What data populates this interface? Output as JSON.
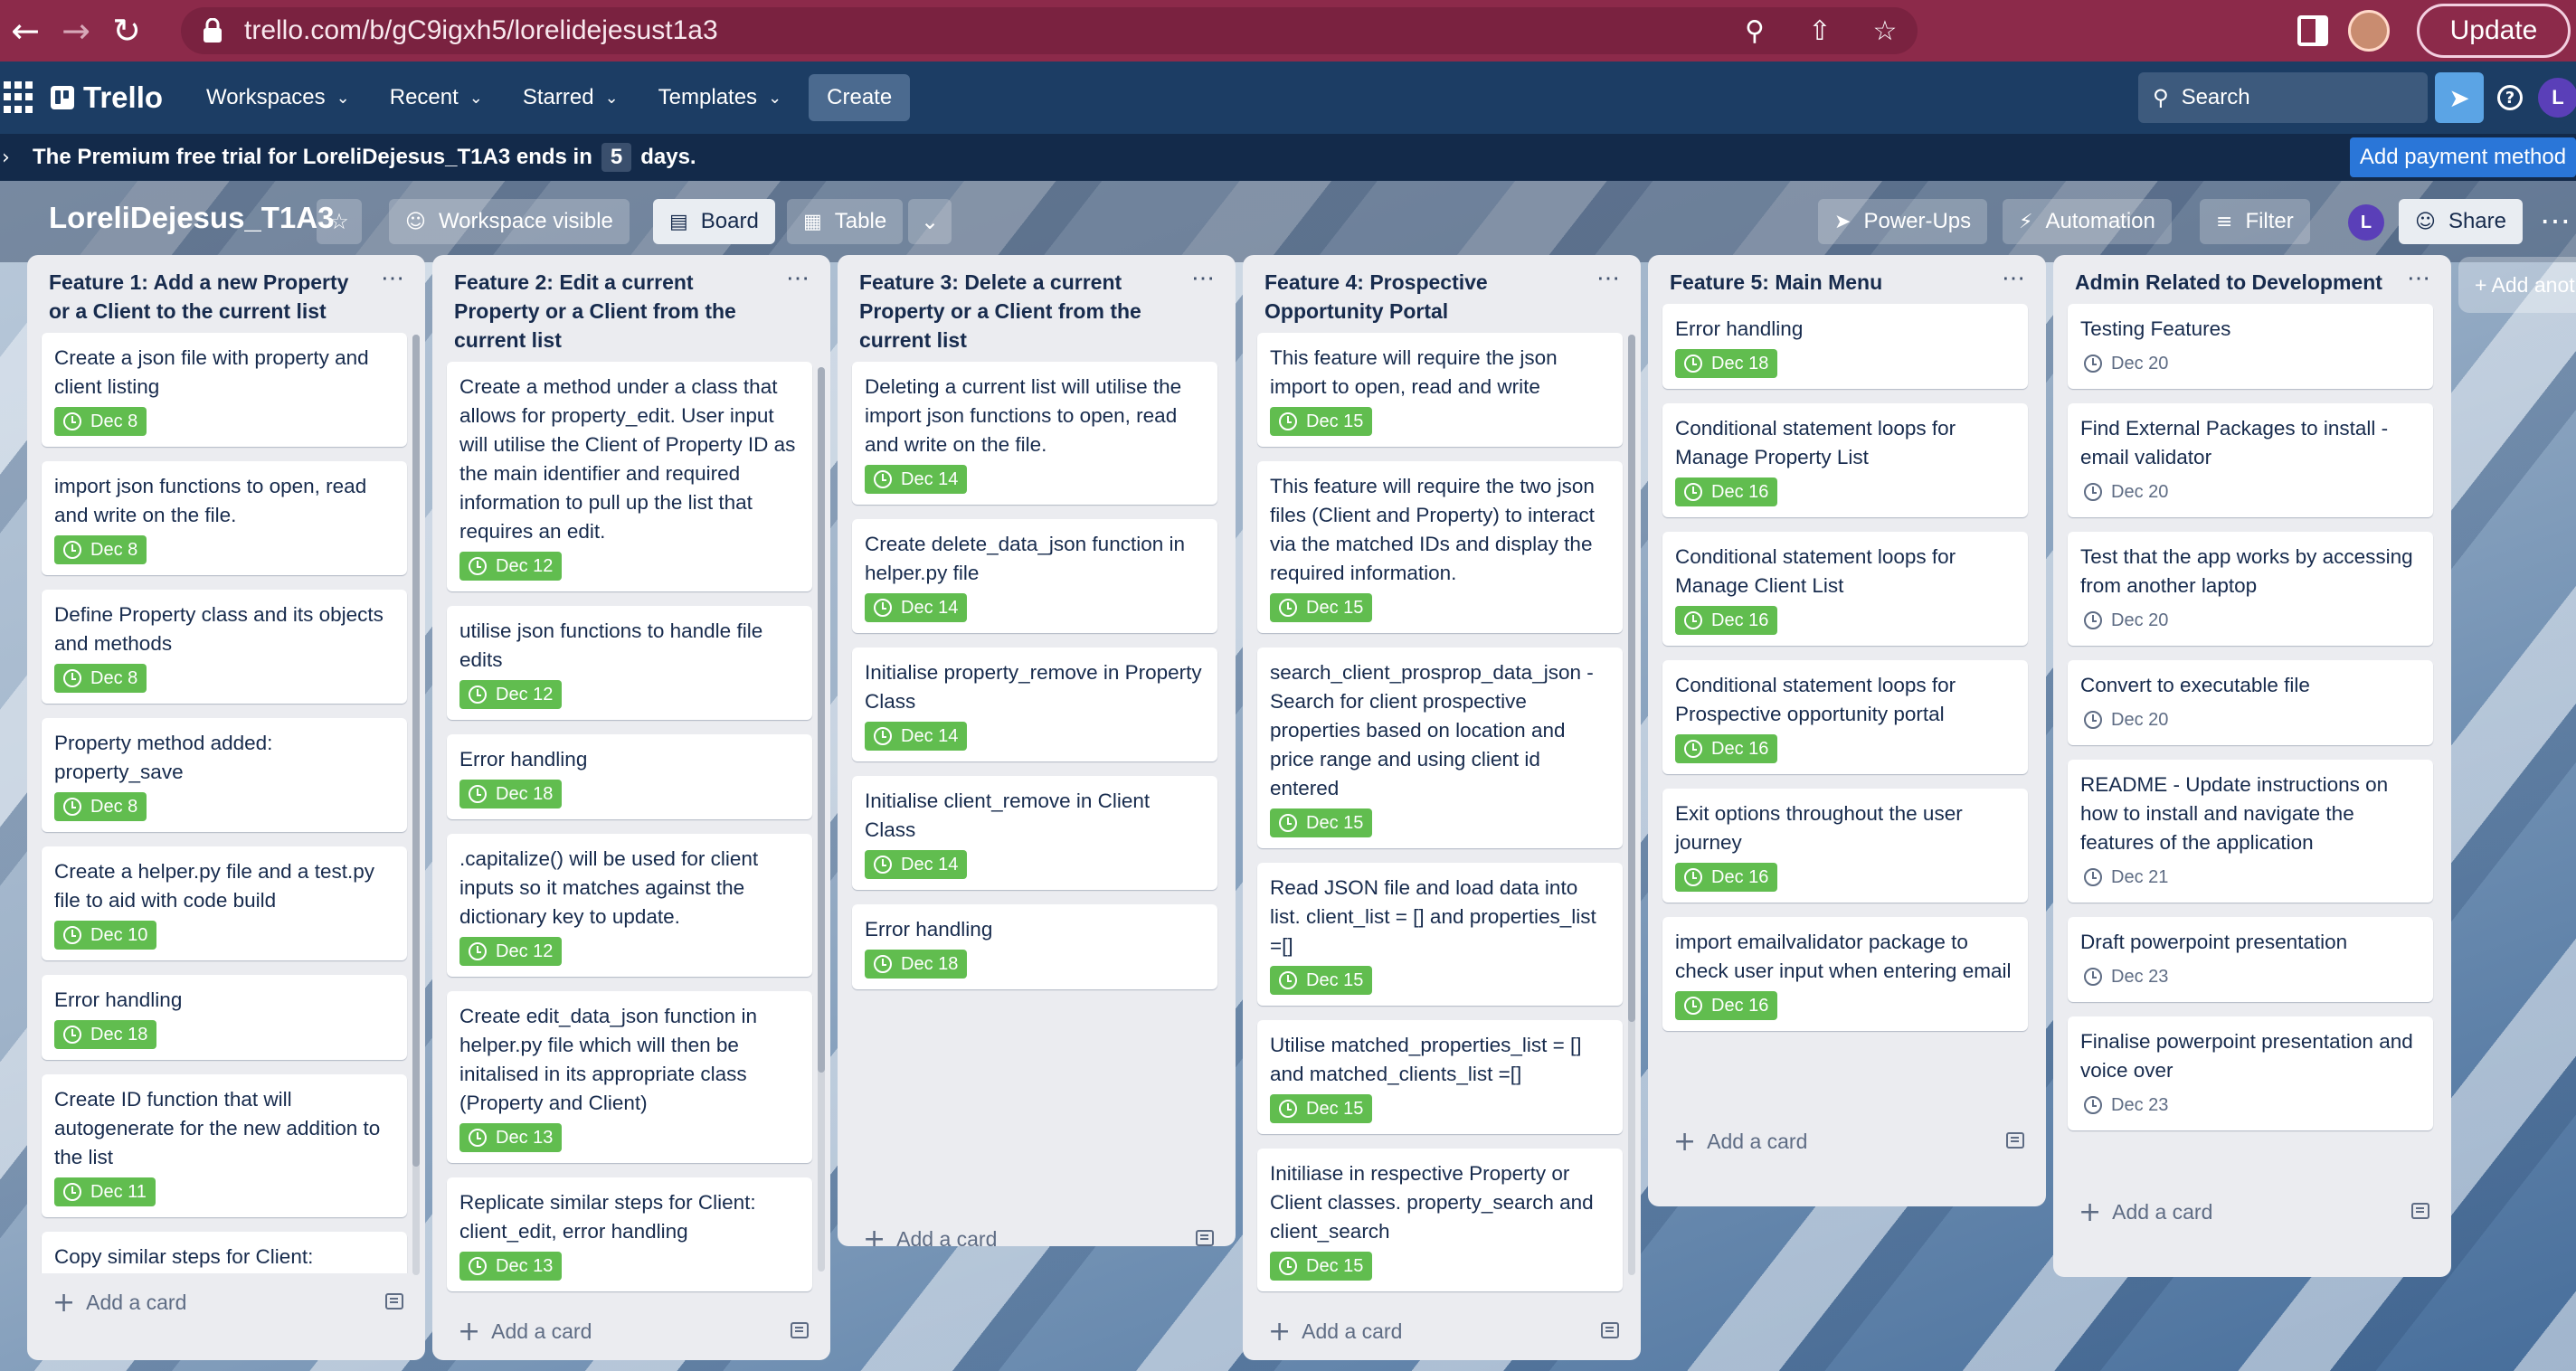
{
  "browser": {
    "url": "trello.com/b/gC9igxh5/lorelidejesust1a3",
    "update_label": "Update"
  },
  "header": {
    "logo": "Trello",
    "menus": [
      "Workspaces",
      "Recent",
      "Starred",
      "Templates"
    ],
    "create_label": "Create",
    "search_placeholder": "Search",
    "avatar_initial": "L"
  },
  "banner": {
    "text_before": "The Premium free trial for LoreliDejesus_T1A3 ends in",
    "days": "5",
    "text_after": "days.",
    "pay_label": "Add payment method"
  },
  "board": {
    "title": "LoreliDejesus_T1A3",
    "workspace_visible": "Workspace visible",
    "board_view": "Board",
    "table_view": "Table",
    "powerups": "Power-Ups",
    "automation": "Automation",
    "filter": "Filter",
    "member_initial": "L",
    "share": "Share",
    "add_list": "+ Add another list",
    "add_card_label": "Add a card"
  },
  "colors": {
    "due_green": "#61bd4f",
    "trello_header": "#1c3d64",
    "browser_bar": "#8c2a4a"
  },
  "lists": [
    {
      "title": "Feature 1: Add a new Property or a Client to the current list",
      "cards": [
        {
          "text": "Create a json file with property and client listing",
          "due": "Dec 8",
          "done": true
        },
        {
          "text": "import json functions to open, read and write on the file.",
          "due": "Dec 8",
          "done": true
        },
        {
          "text": "Define Property class and its objects and methods",
          "due": "Dec 8",
          "done": true
        },
        {
          "text": "Property method added: property_save",
          "due": "Dec 8",
          "done": true
        },
        {
          "text": "Create a helper.py file and a test.py file to aid with code build",
          "due": "Dec 10",
          "done": true
        },
        {
          "text": "Error handling",
          "due": "Dec 18",
          "done": true
        },
        {
          "text": "Create ID function that will autogenerate for the new addition to the list",
          "due": "Dec 11",
          "done": true
        },
        {
          "text": "Copy similar steps for Client: client_save, error handling, id",
          "due": "",
          "done": false
        }
      ]
    },
    {
      "title": "Feature 2: Edit a current Property or a Client from the current list",
      "cards": [
        {
          "text": "Create a method under a class that allows for property_edit. User input will utilise the Client of Property ID as the main identifier and required information to pull up the list that requires an edit.",
          "due": "Dec 12",
          "done": true
        },
        {
          "text": "utilise json functions to handle file edits",
          "due": "Dec 12",
          "done": true
        },
        {
          "text": "Error handling",
          "due": "Dec 18",
          "done": true
        },
        {
          "text": ".capitalize() will be used for client inputs so it matches against the dictionary key to update.",
          "due": "Dec 12",
          "done": true
        },
        {
          "text": "Create edit_data_json function in helper.py file which will then be initalised in its appropriate class (Property and Client)",
          "due": "Dec 13",
          "done": true
        },
        {
          "text": "Replicate similar steps for Client: client_edit, error handling",
          "due": "Dec 13",
          "done": true
        }
      ]
    },
    {
      "title": "Feature 3: Delete a current Property or a Client from the current list",
      "cards": [
        {
          "text": "Deleting a current list will utilise the import json functions to open, read and write on the file.",
          "due": "Dec 14",
          "done": true
        },
        {
          "text": "Create delete_data_json function in helper.py file",
          "due": "Dec 14",
          "done": true
        },
        {
          "text": "Initialise property_remove in Property Class",
          "due": "Dec 14",
          "done": true
        },
        {
          "text": "Initialise client_remove in Client Class",
          "due": "Dec 14",
          "done": true
        },
        {
          "text": "Error handling",
          "due": "Dec 18",
          "done": true
        }
      ]
    },
    {
      "title": "Feature 4: Prospective Opportunity Portal",
      "cards": [
        {
          "text": "This feature will require the json import to open, read and write",
          "due": "Dec 15",
          "done": true
        },
        {
          "text": "This feature will require the two json files (Client and Property) to interact via the matched IDs and display the required information.",
          "due": "Dec 15",
          "done": true
        },
        {
          "text": "search_client_prosprop_data_json - Search for client prospective properties based on location and price range and using client id entered",
          "due": "Dec 15",
          "done": true
        },
        {
          "text": "Read JSON file and load data into list. client_list = [] and properties_list =[]",
          "due": "Dec 15",
          "done": true
        },
        {
          "text": "Utilise matched_properties_list = [] and matched_clients_list =[]",
          "due": "Dec 15",
          "done": true
        },
        {
          "text": "Initiliase in respective Property or Client classes. property_search and client_search",
          "due": "Dec 15",
          "done": true
        }
      ]
    },
    {
      "title": "Feature 5: Main Menu",
      "cards": [
        {
          "text": "Error handling",
          "due": "Dec 18",
          "done": true
        },
        {
          "text": "Conditional statement loops for Manage Property List",
          "due": "Dec 16",
          "done": true
        },
        {
          "text": "Conditional statement loops for Manage Client List",
          "due": "Dec 16",
          "done": true
        },
        {
          "text": "Conditional statement loops for Prospective opportunity portal",
          "due": "Dec 16",
          "done": true
        },
        {
          "text": "Exit options throughout the user journey",
          "due": "Dec 16",
          "done": true
        },
        {
          "text": "import emailvalidator package to check user input when entering email",
          "due": "Dec 16",
          "done": true
        }
      ]
    },
    {
      "title": "Admin Related to Development",
      "cards": [
        {
          "text": "Testing Features",
          "due": "Dec 20",
          "done": false
        },
        {
          "text": "Find External Packages to install - email validator",
          "due": "Dec 20",
          "done": false
        },
        {
          "text": "Test that the app works by accessing from another laptop",
          "due": "Dec 20",
          "done": false
        },
        {
          "text": "Convert to executable file",
          "due": "Dec 20",
          "done": false
        },
        {
          "text": "README - Update instructions on how to install and navigate the features of the application",
          "due": "Dec 21",
          "done": false
        },
        {
          "text": "Draft powerpoint presentation",
          "due": "Dec 23",
          "done": false
        },
        {
          "text": "Finalise powerpoint presentation and voice over",
          "due": "Dec 23",
          "done": false
        }
      ]
    }
  ]
}
